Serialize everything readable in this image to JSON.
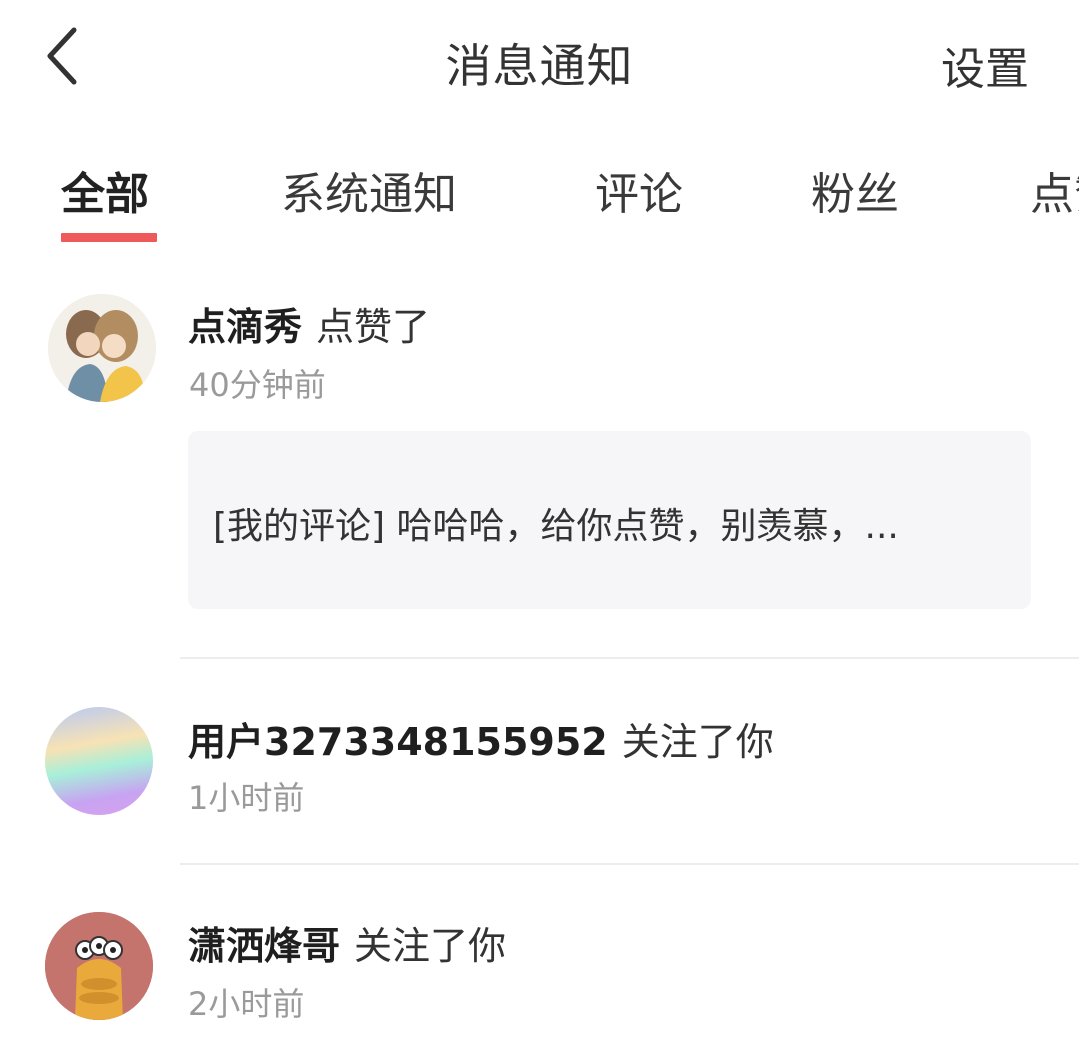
{
  "header": {
    "title": "消息通知",
    "settings_label": "设置",
    "back_icon": "chevron-left-icon"
  },
  "tabs": [
    {
      "label": "全部",
      "active": true
    },
    {
      "label": "系统通知",
      "active": false
    },
    {
      "label": "评论",
      "active": false
    },
    {
      "label": "粉丝",
      "active": false
    },
    {
      "label": "点赞",
      "active": false
    }
  ],
  "accent_color": "#ee5a5a",
  "notifications": [
    {
      "name": "点滴秀",
      "action": "点赞了",
      "time": "40分钟前",
      "quote": "[我的评论] 哈哈哈，给你点赞，别羡慕，...",
      "avatar": "illustrated-couple-avatar"
    },
    {
      "name": "用户3273348155952",
      "action": "关注了你",
      "time": "1小时前",
      "avatar": "gradient-avatar"
    },
    {
      "name": "潇洒烽哥",
      "action": "关注了你",
      "time": "2小时前",
      "avatar": "cartoon-monster-avatar"
    }
  ]
}
